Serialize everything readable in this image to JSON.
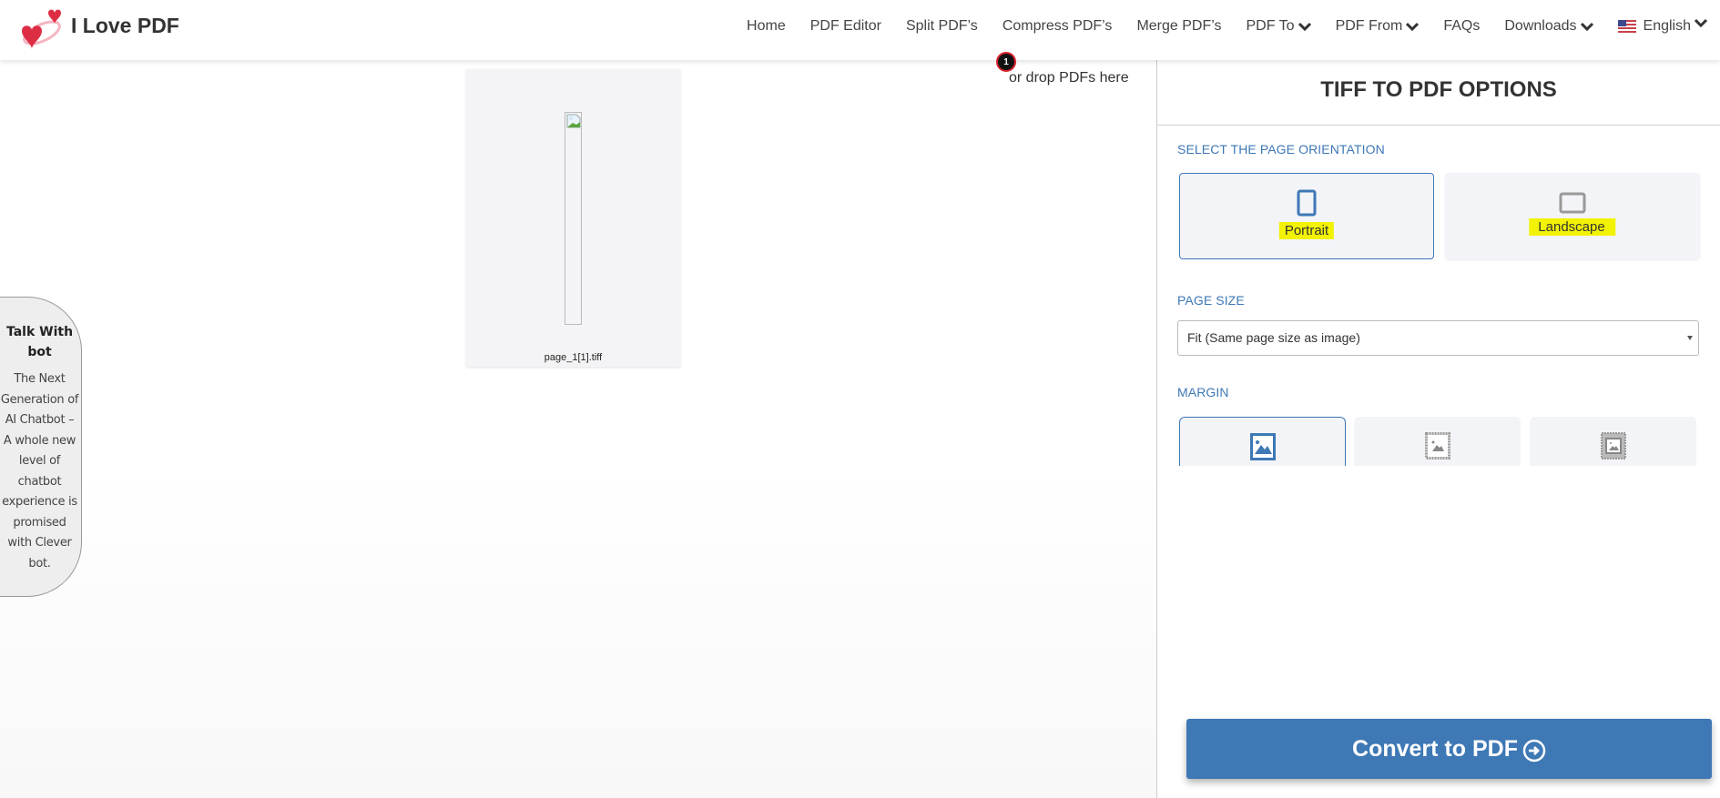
{
  "brand": {
    "name": "I Love PDF",
    "logo_icon": "two-hearts-icon",
    "accent_color": "#3e78b5",
    "heart_color": "#dd2e44"
  },
  "nav": {
    "items": [
      {
        "label": "Home",
        "dropdown": false
      },
      {
        "label": "PDF Editor",
        "dropdown": false
      },
      {
        "label": "Split PDF’s",
        "dropdown": false
      },
      {
        "label": "Compress PDF’s",
        "dropdown": false
      },
      {
        "label": "Merge PDF’s",
        "dropdown": false
      },
      {
        "label": "PDF To",
        "dropdown": true
      },
      {
        "label": "PDF From",
        "dropdown": true
      },
      {
        "label": "FAQs",
        "dropdown": false
      },
      {
        "label": "Downloads",
        "dropdown": true
      }
    ],
    "language": {
      "label": "English",
      "flag_icon": "us-flag-icon"
    }
  },
  "workspace": {
    "drop_badge": "1",
    "drop_text": "or drop PDFs here",
    "files": [
      {
        "name": "page_1[1].tiff",
        "thumbnail_icon": "broken-image-icon"
      }
    ]
  },
  "chatbot": {
    "title": "Talk With bot",
    "body": "The Next Generation of AI Chatbot – A whole new level of chatbot experience is promised with Clever bot."
  },
  "options": {
    "title": "TIFF TO PDF OPTIONS",
    "orientation": {
      "label": "SELECT THE PAGE ORIENTATION",
      "choices": [
        {
          "label": "Portrait",
          "icon": "portrait-page-icon",
          "selected": true
        },
        {
          "label": "Landscape",
          "icon": "landscape-page-icon",
          "selected": false
        }
      ]
    },
    "page_size": {
      "label": "PAGE SIZE",
      "selected": "Fit (Same page size as image)"
    },
    "margin": {
      "label": "MARGIN",
      "choices": [
        {
          "name": "no-margin",
          "icon": "image-no-margin-icon",
          "selected": true
        },
        {
          "name": "small-margin",
          "icon": "image-small-margin-icon",
          "selected": false
        },
        {
          "name": "big-margin",
          "icon": "image-big-margin-icon",
          "selected": false
        }
      ]
    },
    "convert_label": "Convert to PDF",
    "convert_icon": "arrow-circle-right-icon"
  }
}
